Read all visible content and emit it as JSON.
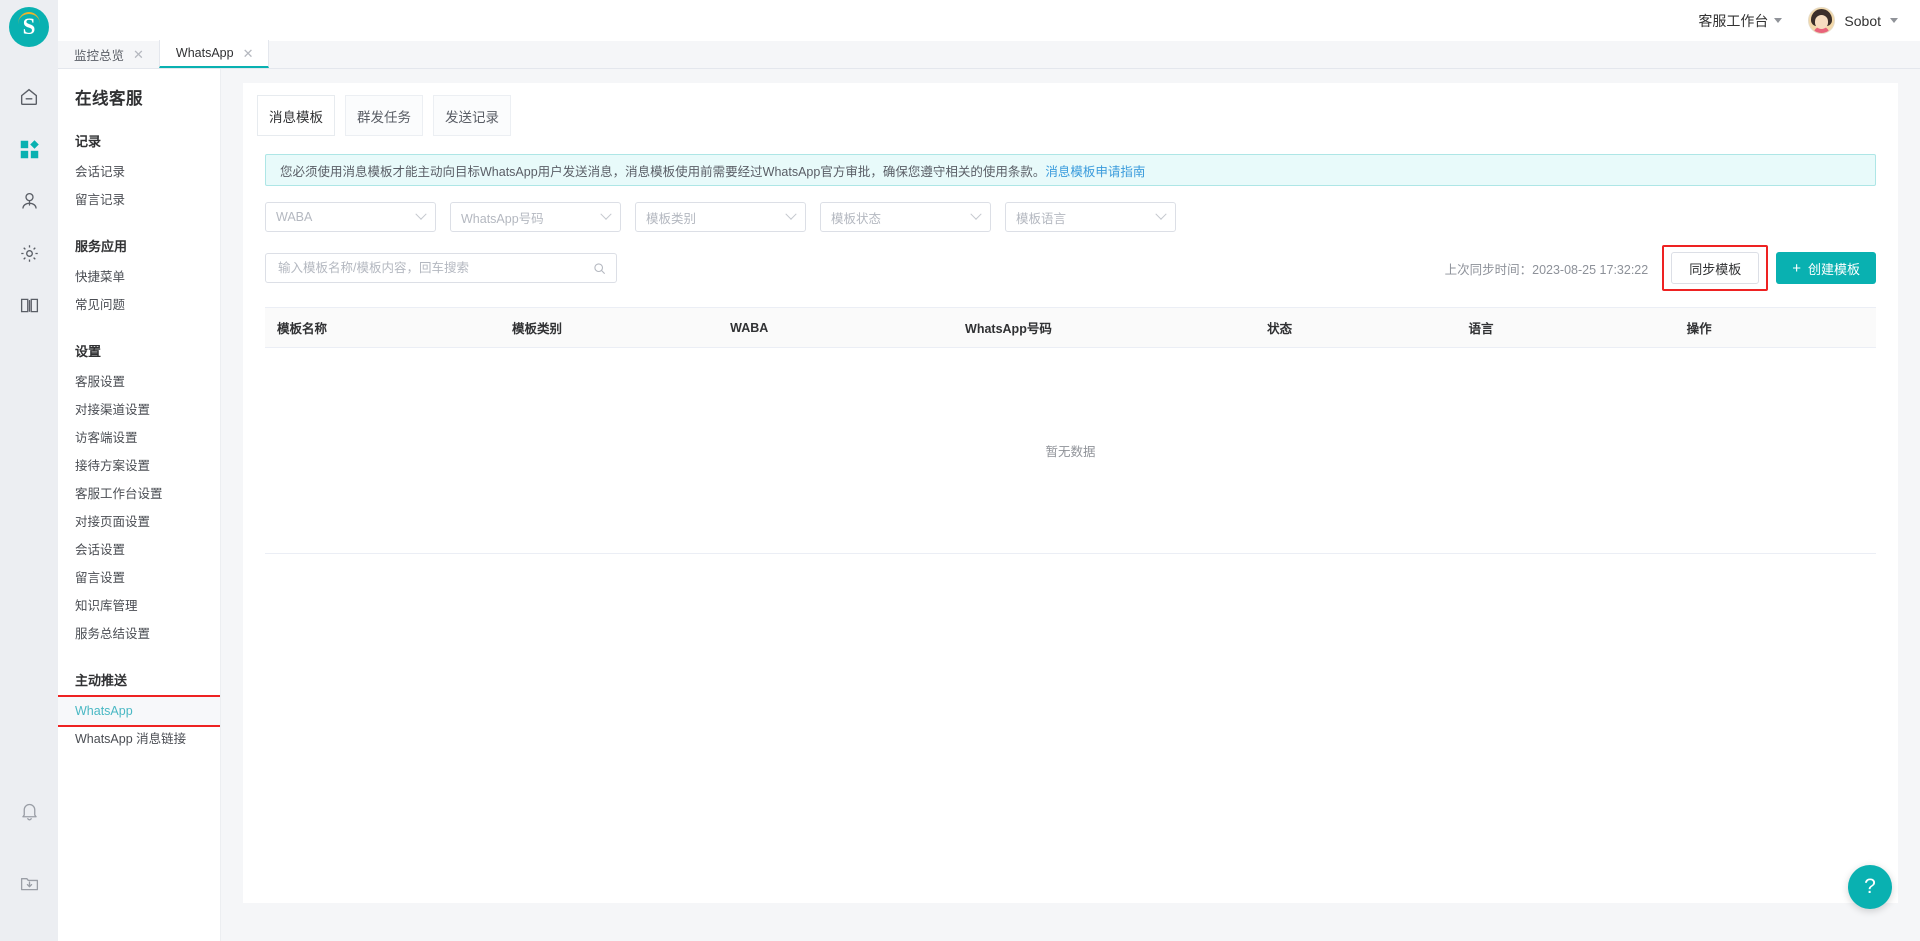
{
  "brand": {
    "logo_letter": "S",
    "accent": "#09b1b1",
    "highlight": "#ee2222"
  },
  "topbar": {
    "workbench_label": "客服工作台",
    "user_name": "Sobot"
  },
  "window_tabs": [
    {
      "label": "监控总览",
      "close": "✕",
      "active": false
    },
    {
      "label": "WhatsApp",
      "close": "✕",
      "active": true
    }
  ],
  "rail_icons": [
    {
      "name": "home-icon"
    },
    {
      "name": "apps-icon"
    },
    {
      "name": "user-icon"
    },
    {
      "name": "gear-icon"
    },
    {
      "name": "book-icon"
    },
    {
      "name": "bell-icon"
    },
    {
      "name": "download-folder-icon"
    }
  ],
  "sidebar": {
    "title": "在线客服",
    "groups": [
      {
        "label": "记录",
        "items": [
          {
            "label": "会话记录"
          },
          {
            "label": "留言记录"
          }
        ]
      },
      {
        "label": "服务应用",
        "items": [
          {
            "label": "快捷菜单"
          },
          {
            "label": "常见问题"
          }
        ]
      },
      {
        "label": "设置",
        "items": [
          {
            "label": "客服设置"
          },
          {
            "label": "对接渠道设置"
          },
          {
            "label": "访客端设置"
          },
          {
            "label": "接待方案设置"
          },
          {
            "label": "客服工作台设置"
          },
          {
            "label": "对接页面设置"
          },
          {
            "label": "会话设置"
          },
          {
            "label": "留言设置"
          },
          {
            "label": "知识库管理"
          },
          {
            "label": "服务总结设置"
          }
        ]
      },
      {
        "label": "主动推送",
        "items": [
          {
            "label": "WhatsApp",
            "current": true,
            "highlighted": true
          },
          {
            "label": "WhatsApp 消息链接"
          }
        ]
      }
    ]
  },
  "main": {
    "tabs": [
      {
        "label": "消息模板",
        "active": true
      },
      {
        "label": "群发任务",
        "active": false
      },
      {
        "label": "发送记录",
        "active": false
      }
    ],
    "notice": {
      "text": "您必须使用消息模板才能主动向目标WhatsApp用户发送消息，消息模板使用前需要经过WhatsApp官方审批，确保您遵守相关的使用条款。",
      "link": "消息模板申请指南"
    },
    "filters": [
      {
        "placeholder": "WABA"
      },
      {
        "placeholder": "WhatsApp号码"
      },
      {
        "placeholder": "模板类别"
      },
      {
        "placeholder": "模板状态"
      },
      {
        "placeholder": "模板语言"
      }
    ],
    "search": {
      "placeholder": "输入模板名称/模板内容，回车搜索",
      "value": ""
    },
    "sync_time_label": "上次同步时间：2023-08-25 17:32:22",
    "sync_button": "同步模板",
    "create_button": "创建模板",
    "create_button_plus": "+",
    "table": {
      "columns": [
        "模板名称",
        "模板类别",
        "WABA",
        "WhatsApp号码",
        "状态",
        "语言",
        "操作"
      ],
      "rows": [],
      "empty_text": "暂无数据"
    }
  },
  "help_fab": {
    "glyph": "?"
  }
}
